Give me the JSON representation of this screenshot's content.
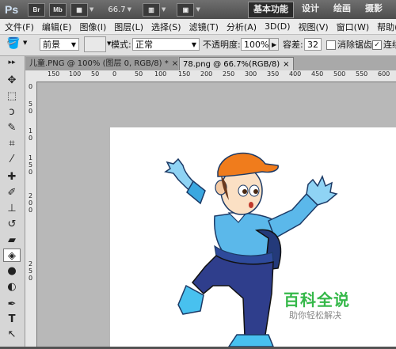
{
  "titlebar": {
    "app_logo": "Ps",
    "buttons": [
      "Br",
      "Mb"
    ],
    "zoom": "66.7",
    "workspaces": [
      "基本功能",
      "设计",
      "绘画",
      "摄影"
    ]
  },
  "menu": [
    "文件(F)",
    "编辑(E)",
    "图像(I)",
    "图层(L)",
    "选择(S)",
    "滤镜(T)",
    "分析(A)",
    "3D(D)",
    "视图(V)",
    "窗口(W)",
    "帮助(H)"
  ],
  "options": {
    "fill_source": "前景",
    "mode_label": "模式:",
    "mode_value": "正常",
    "opacity_label": "不透明度:",
    "opacity_value": "100%",
    "tolerance_label": "容差:",
    "tolerance_value": "32",
    "antialias_label": "消除锯齿",
    "contiguous_label": "连续"
  },
  "tabs": [
    {
      "label": "儿童.PNG @ 100% (图层 0, RGB/8) *",
      "close": "×"
    },
    {
      "label": "78.png @ 66.7%(RGB/8)",
      "close": "×"
    }
  ],
  "ruler": {
    "h_ticks": [
      "150",
      "100",
      "50",
      "0",
      "50",
      "100",
      "150",
      "200",
      "250",
      "300",
      "350",
      "400",
      "450",
      "500",
      "550",
      "600"
    ],
    "v_ticks": [
      "0",
      "5",
      "0",
      "1",
      "0",
      "1",
      "5",
      "0",
      "2",
      "0",
      "0",
      "2",
      "5",
      "0"
    ]
  },
  "watermark": {
    "title": "百科全说",
    "subtitle": "助你轻松解决"
  },
  "colors": {
    "accent_green": "#35b849",
    "titlebar": "#4d4d4d",
    "canvas_bg": "#b8b8b8"
  }
}
